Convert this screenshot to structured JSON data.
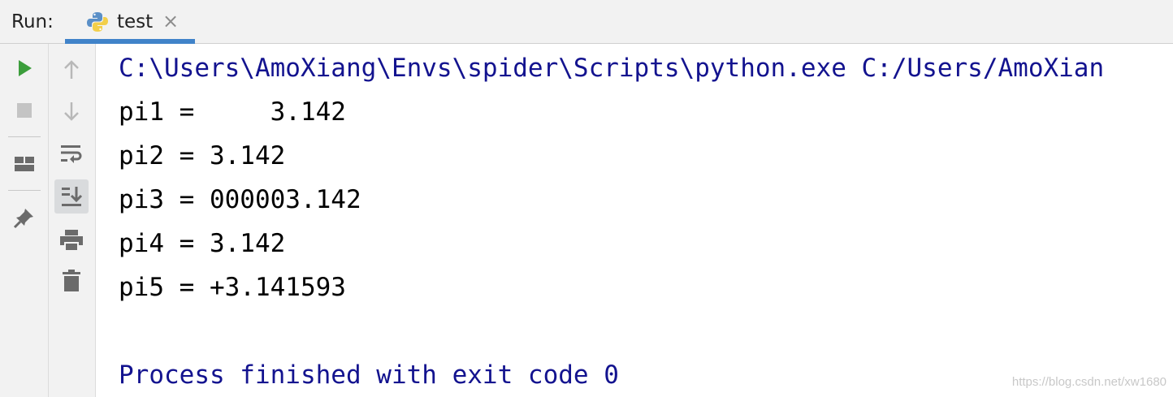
{
  "run_panel": {
    "label": "Run:",
    "tab": {
      "label": "test",
      "icon": "python-icon",
      "close": "×"
    }
  },
  "toolbar": {
    "run": "run-icon",
    "stop": "stop-icon",
    "layout": "layout-icon",
    "pin": "pin-icon",
    "up": "arrow-up-icon",
    "down": "arrow-down-icon",
    "wrap": "soft-wrap-icon",
    "scroll_end": "scroll-to-end-icon",
    "print": "print-icon",
    "trash": "trash-icon"
  },
  "console": {
    "command": "C:\\Users\\AmoXiang\\Envs\\spider\\Scripts\\python.exe C:/Users/AmoXian",
    "lines": [
      "pi1 =     3.142",
      "pi2 = 3.142",
      "pi3 = 000003.142",
      "pi4 = 3.142",
      "pi5 = +3.141593"
    ],
    "exit": "Process finished with exit code 0"
  },
  "watermark": "https://blog.csdn.net/xw1680",
  "colors": {
    "accent": "#4083c9",
    "run_green": "#3c9e3c",
    "console_blue": "#13138f"
  }
}
